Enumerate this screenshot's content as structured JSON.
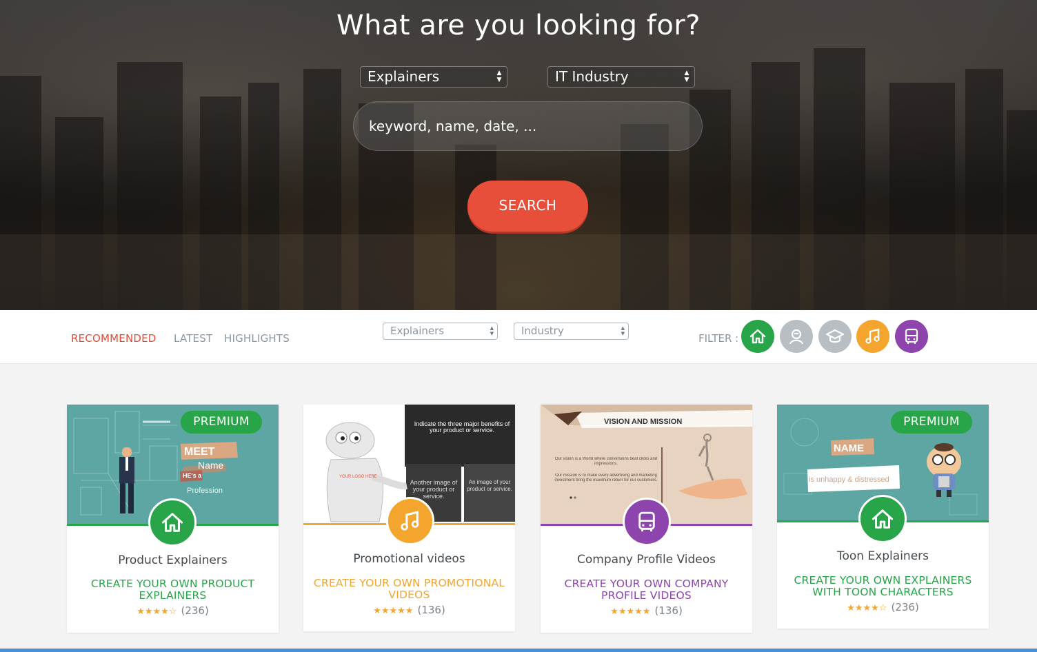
{
  "hero": {
    "title": "What are you looking for?",
    "type_select": "Explainers",
    "industry_select": "IT Industry",
    "search_placeholder": "keyword, name, date, ...",
    "search_button": "SEARCH"
  },
  "filterbar": {
    "tabs": [
      {
        "label": "RECOMMENDED",
        "active": true
      },
      {
        "label": "LATEST",
        "active": false
      },
      {
        "label": "HIGHLIGHTS",
        "active": false
      }
    ],
    "type_select": "Explainers",
    "industry_select": "Industry",
    "filter_label": "FILTER :",
    "filter_icons": [
      {
        "icon": "house-icon",
        "color": "#27a548"
      },
      {
        "icon": "person-icon",
        "color": "#b8bec2"
      },
      {
        "icon": "graduation-cap-icon",
        "color": "#b8bec2"
      },
      {
        "icon": "music-note-icon",
        "color": "#f3a52e"
      },
      {
        "icon": "bus-icon",
        "color": "#8e44ad"
      }
    ]
  },
  "cards": [
    {
      "premium": "PREMIUM",
      "title": "Product Explainers",
      "cta": "CREATE YOUR OWN PRODUCT EXPLAINERS",
      "rating_stars": 4,
      "reviews": "(236)",
      "accent": "#27a548",
      "icon": "house-icon",
      "thumb_text": {
        "meet": "MEET",
        "name": "Name",
        "hes": "HE's a",
        "profession": "Profession"
      }
    },
    {
      "premium": "",
      "title": "Promotional videos",
      "cta": "CREATE YOUR OWN PROMOTIONAL VIDEOS",
      "rating_stars": 5,
      "reviews": "(136)",
      "accent": "#f3a52e",
      "icon": "music-note-icon",
      "thumb_text": {
        "logo": "YOUR LOGO HERE",
        "indicate": "Indicate the three major benefits of your product or service.",
        "another": "Another image of your product or service.",
        "an_image": "An image of your product or service."
      }
    },
    {
      "premium": "",
      "title": "Company Profile Videos",
      "cta": "CREATE YOUR OWN COMPANY PROFILE VIDEOS",
      "rating_stars": 5,
      "reviews": "(136)",
      "accent": "#8e44ad",
      "icon": "bus-icon",
      "thumb_text": {
        "heading": "VISION AND MISSION",
        "vision": "Our vision is a World where conversions beat clicks and impressions.",
        "mission": "Our mission is to make every advertising and marketing investment bring the maximum return for our customers."
      }
    },
    {
      "premium": "PREMIUM",
      "title": "Toon Explainers",
      "cta": "CREATE YOUR OWN EXPLAINERS WITH TOON CHARACTERS",
      "rating_stars": 4,
      "reviews": "(236)",
      "accent": "#27a548",
      "icon": "house-icon",
      "thumb_text": {
        "name": "NAME",
        "sub": "is unhappy & distressed"
      }
    }
  ]
}
